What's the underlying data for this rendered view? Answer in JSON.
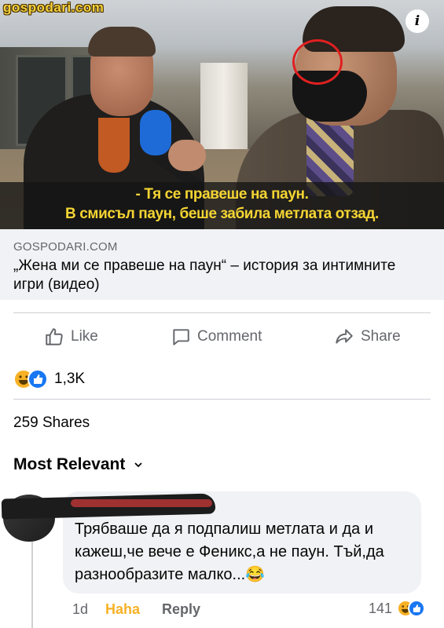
{
  "photo": {
    "watermark": "gospodari.com",
    "info_icon": "i",
    "subtitle_line1": "- Тя се правеше на паун.",
    "subtitle_line2": "В смисъл паун, беше забила метлата отзад."
  },
  "link": {
    "domain": "GOSPODARI.COM",
    "headline": "„Жена ми се правеше на паун“ – история за интимните игри (видео)"
  },
  "actions": {
    "like": "Like",
    "comment": "Comment",
    "share": "Share"
  },
  "reactions": {
    "count": "1,3K",
    "icons": [
      "haha-emoji-icon",
      "like-thumb-icon"
    ]
  },
  "shares": "259 Shares",
  "sort": {
    "label": "Most Relevant"
  },
  "comment": {
    "text": "Трябваше да я подпалиш метлата и да и кажеш,че вече е Феникс,а не паун. Тъй,да разнообразите малко...😂",
    "time": "1d",
    "reaction_label": "Haha",
    "reply_label": "Reply",
    "reaction_count": "141"
  },
  "colors": {
    "subtitle_yellow": "#f5d533",
    "haha_yellow": "#f7b125",
    "like_blue": "#1877f2",
    "muted_gray": "#65676b",
    "link_box_bg": "#f0f2f5"
  }
}
